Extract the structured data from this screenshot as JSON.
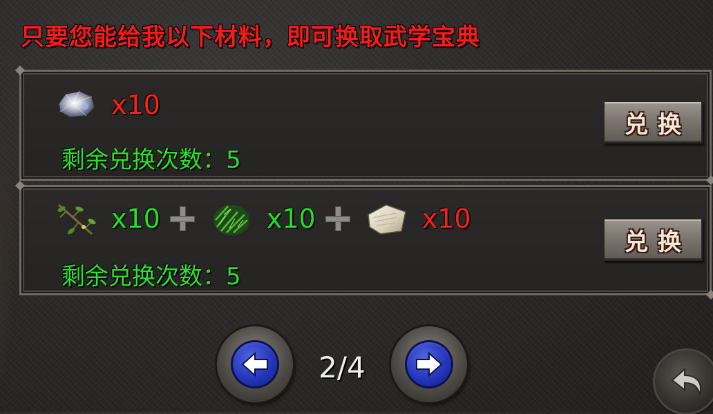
{
  "instruction": "只要您能给我以下材料，即可换取武学宝典",
  "exchanges": [
    {
      "items": [
        {
          "icon": "gem-ore-icon",
          "qty": "x10",
          "qty_color": "red"
        }
      ],
      "remaining_label": "剩余兑换次数：5",
      "button_label": "兑换"
    },
    {
      "items": [
        {
          "icon": "herb-branch-icon",
          "qty": "x10",
          "qty_color": "green"
        },
        {
          "icon": "green-herb-bundle-icon",
          "qty": "x10",
          "qty_color": "green"
        },
        {
          "icon": "paper-scroll-icon",
          "qty": "x10",
          "qty_color": "red"
        }
      ],
      "remaining_label": "剩余兑换次数：5",
      "button_label": "兑换"
    }
  ],
  "pagination": {
    "current": 2,
    "total": 4,
    "label": "2/4"
  },
  "colors": {
    "instruction": "#ff1a1a",
    "qty_red": "#ff1f1f",
    "qty_green": "#22e022",
    "remaining": "#2ee02e",
    "nav_blue": "#2233b8"
  }
}
